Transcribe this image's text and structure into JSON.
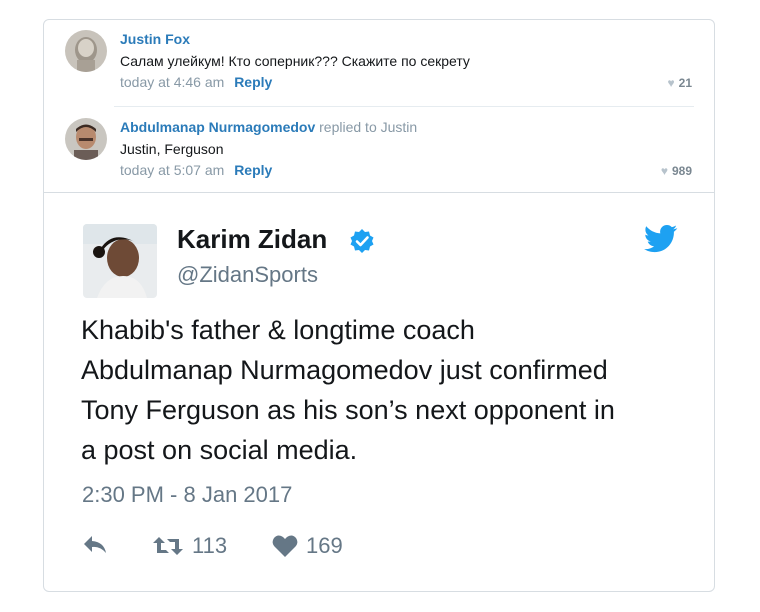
{
  "comments": [
    {
      "author": "Justin Fox",
      "replied_to": "",
      "text": "Салам улейкум! Кто соперник??? Скажите по секрету",
      "time": "today at 4:46 am",
      "reply_label": "Reply",
      "likes": "21"
    },
    {
      "author": "Abdulmanap Nurmagomedov",
      "replied_to": "replied to Justin",
      "text": "Justin, Ferguson",
      "time": "today at 5:07 am",
      "reply_label": "Reply",
      "likes": "989"
    }
  ],
  "tweet": {
    "name": "Karim Zidan",
    "handle": "@ZidanSports",
    "text_lines": [
      "Khabib's father & longtime coach",
      "Abdulmanap Nurmagomedov just confirmed",
      "Tony Ferguson as his son’s next opponent in",
      "a post on social media."
    ],
    "date": "2:30 PM - 8 Jan 2017",
    "retweets": "113",
    "likes": "169"
  },
  "icons": {
    "verified": "verified-badge-icon",
    "brand": "twitter-bird-icon",
    "reply": "reply-arrow-icon",
    "retweet": "retweet-icon",
    "like": "heart-icon"
  },
  "colors": {
    "link": "#2b7bb9",
    "twitter_blue": "#1da1f2",
    "muted": "#657786",
    "border": "#d7dde2"
  }
}
